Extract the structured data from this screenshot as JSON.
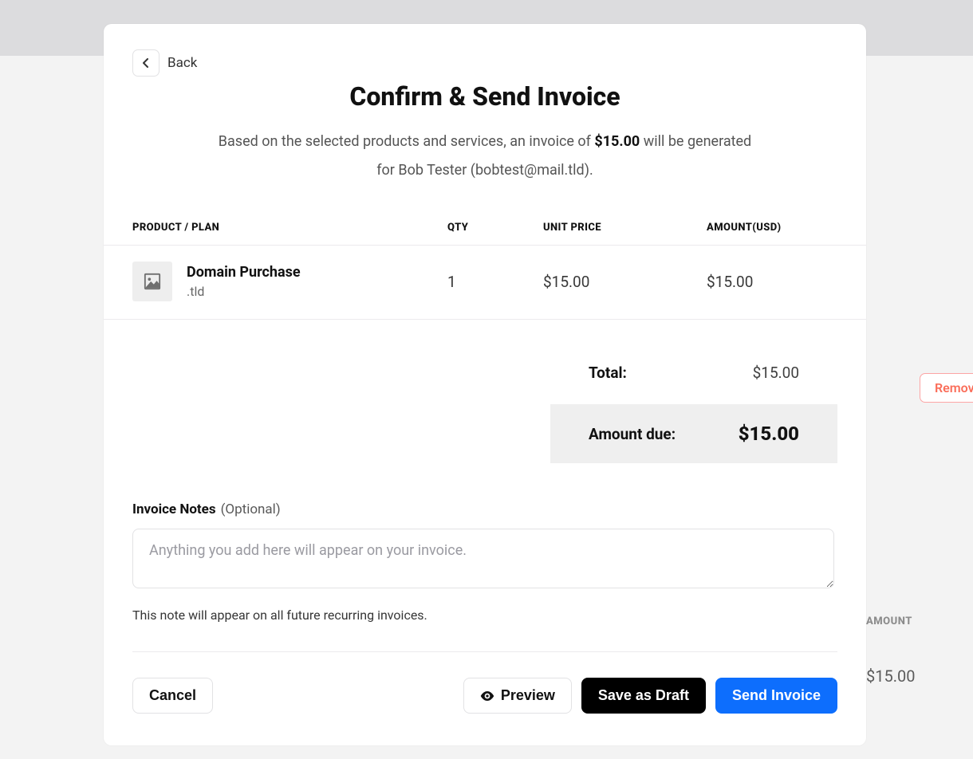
{
  "back_label": "Back",
  "title": "Confirm & Send Invoice",
  "subtitle_pre": "Based on the selected products and services, an invoice of ",
  "subtitle_amount": "$15.00",
  "subtitle_mid": " will be generated for ",
  "subtitle_name": "Bob Tester (bobtest@mail.tld)",
  "subtitle_post": ".",
  "headers": {
    "product": "PRODUCT / PLAN",
    "qty": "QTY",
    "unit": "UNIT PRICE",
    "amount": "AMOUNT(USD)"
  },
  "row": {
    "name": "Domain Purchase",
    "sub": ".tld",
    "qty": "1",
    "unit": "$15.00",
    "amount": "$15.00"
  },
  "totals": {
    "total_label": "Total:",
    "total_value": "$15.00",
    "due_label": "Amount due:",
    "due_value": "$15.00"
  },
  "notes": {
    "label": "Invoice Notes",
    "optional": "(Optional)",
    "placeholder": "Anything you add here will appear on your invoice.",
    "hint": "This note will appear on all future recurring invoices."
  },
  "buttons": {
    "cancel": "Cancel",
    "preview": "Preview",
    "draft": "Save as Draft",
    "send": "Send Invoice"
  },
  "background": {
    "remove": "Remove",
    "amount_label": "AMOUNT",
    "amount_value": "$15.00"
  }
}
